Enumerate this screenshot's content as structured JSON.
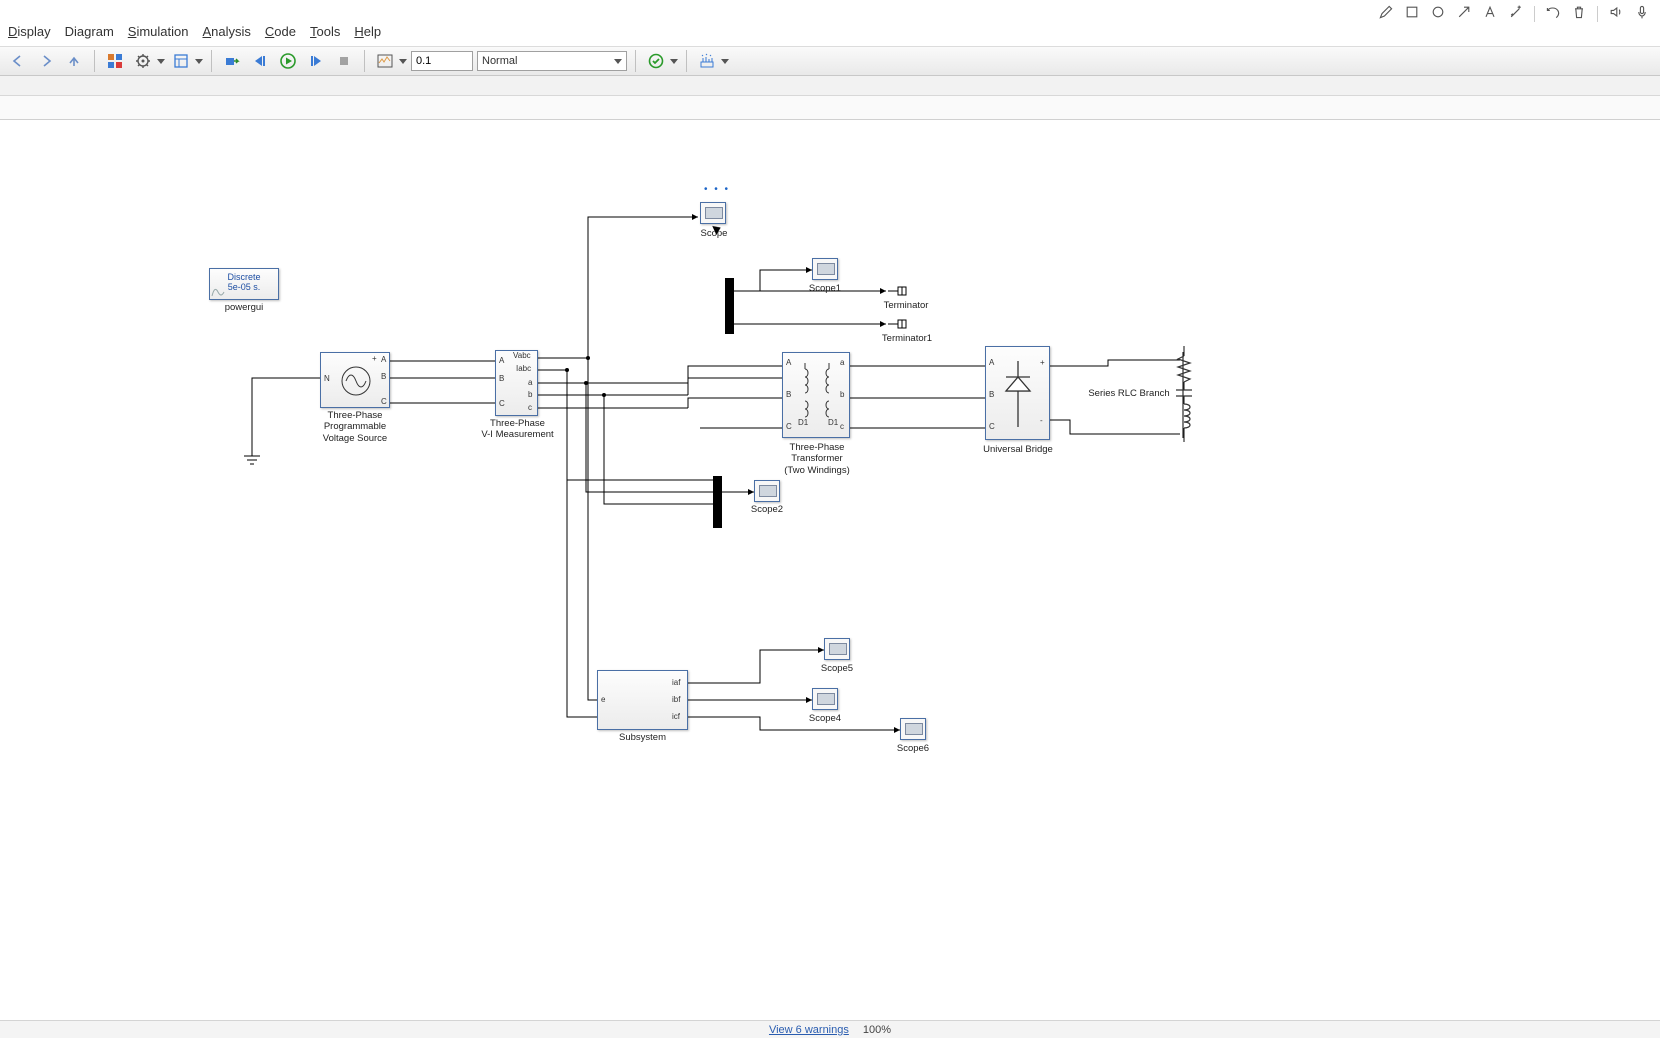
{
  "menus": {
    "display": "Display",
    "diagram": "Diagram",
    "simulation": "Simulation",
    "analysis": "Analysis",
    "code": "Code",
    "tools": "Tools",
    "help": "Help"
  },
  "toolbar": {
    "stop_time": "0.1",
    "sim_mode": "Normal"
  },
  "gui": {
    "powergui_line1": "Discrete",
    "powergui_line2": "5e-05 s.",
    "powergui_label": "powergui"
  },
  "blocks": {
    "source_label": "Three-Phase\nProgrammable\nVoltage Source",
    "vi_label": "Three-Phase\nV-I Measurement",
    "vi_Vabc": "Vabc",
    "vi_Iabc": "Iabc",
    "vi_a": "a",
    "vi_b": "b",
    "vi_c": "c",
    "vi_A": "A",
    "vi_B": "B",
    "vi_C": "C",
    "xfmr_label": "Three-Phase\nTransformer\n(Two Windings)",
    "xfmr_D1a": "D1",
    "xfmr_D1b": "D1",
    "bridge_label": "Universal Bridge",
    "rlc_label": "Series RLC Branch",
    "subsys_label": "Subsystem",
    "subsys_in": "e",
    "subsys_iaf": "iaf",
    "subsys_ibf": "ibf",
    "subsys_icf": "icf",
    "scope0": "Scope",
    "scope1": "Scope1",
    "scope2": "Scope2",
    "scope4": "Scope4",
    "scope5": "Scope5",
    "scope6": "Scope6",
    "terminator": "Terminator",
    "terminator1": "Terminator1",
    "port_A": "A",
    "port_B": "B",
    "port_C": "C",
    "port_a": "a",
    "port_b": "b",
    "port_c": "c",
    "port_N": "N",
    "port_plus": "+",
    "port_minus": "-"
  },
  "status": {
    "warnings": "View 6 warnings",
    "zoom": "100%"
  }
}
